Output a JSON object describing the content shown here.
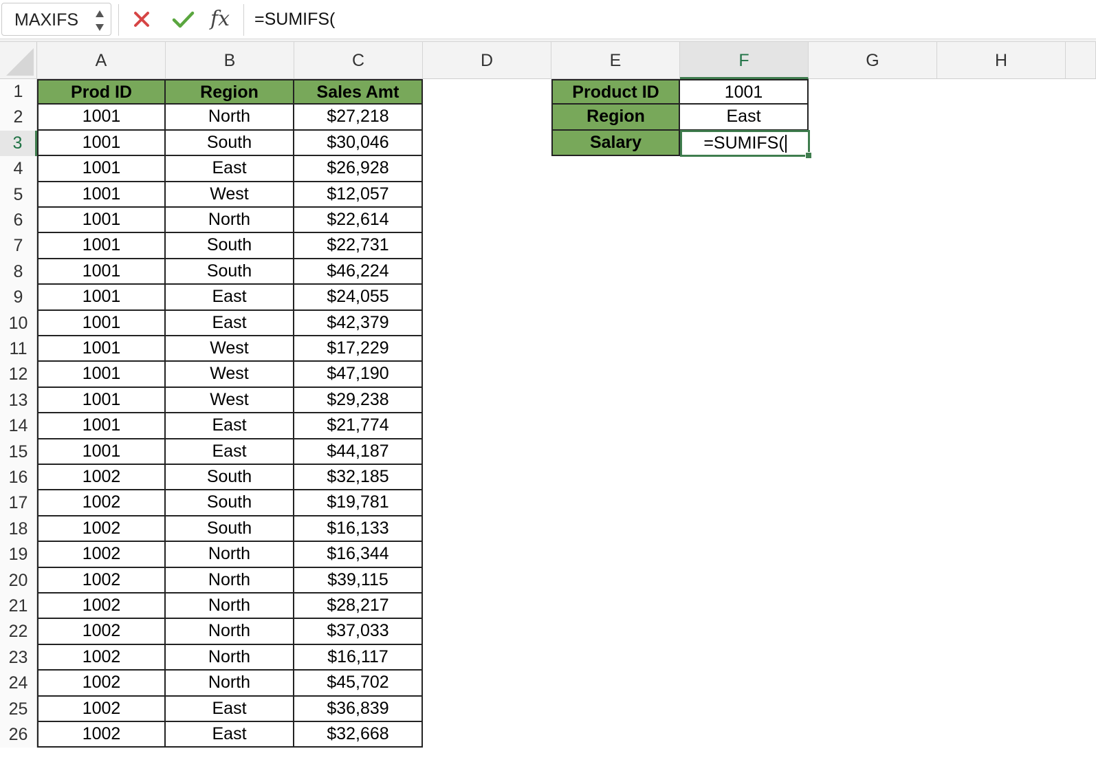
{
  "formula_bar": {
    "name_box": "MAXIFS",
    "cancel_icon": "close-icon",
    "enter_icon": "checkmark-icon",
    "fx_label": "fx",
    "formula": "=SUMIFS("
  },
  "grid": {
    "columns": [
      "A",
      "B",
      "C",
      "D",
      "E",
      "F",
      "G",
      "H"
    ],
    "selected_column": "F",
    "selected_row": "3",
    "rows": [
      "1",
      "2",
      "3",
      "4",
      "5",
      "6",
      "7",
      "8",
      "9",
      "10",
      "11",
      "12",
      "13",
      "14",
      "15",
      "16",
      "17",
      "18",
      "19",
      "20",
      "21",
      "22",
      "23",
      "24",
      "25",
      "26"
    ]
  },
  "table": {
    "headers": [
      "Prod ID",
      "Region",
      "Sales Amt"
    ],
    "rows": [
      [
        "1001",
        "North",
        "$27,218"
      ],
      [
        "1001",
        "South",
        "$30,046"
      ],
      [
        "1001",
        "East",
        "$26,928"
      ],
      [
        "1001",
        "West",
        "$12,057"
      ],
      [
        "1001",
        "North",
        "$22,614"
      ],
      [
        "1001",
        "South",
        "$22,731"
      ],
      [
        "1001",
        "South",
        "$46,224"
      ],
      [
        "1001",
        "East",
        "$24,055"
      ],
      [
        "1001",
        "East",
        "$42,379"
      ],
      [
        "1001",
        "West",
        "$17,229"
      ],
      [
        "1001",
        "West",
        "$47,190"
      ],
      [
        "1001",
        "West",
        "$29,238"
      ],
      [
        "1001",
        "East",
        "$21,774"
      ],
      [
        "1001",
        "East",
        "$44,187"
      ],
      [
        "1002",
        "South",
        "$32,185"
      ],
      [
        "1002",
        "South",
        "$19,781"
      ],
      [
        "1002",
        "South",
        "$16,133"
      ],
      [
        "1002",
        "North",
        "$16,344"
      ],
      [
        "1002",
        "North",
        "$39,115"
      ],
      [
        "1002",
        "North",
        "$28,217"
      ],
      [
        "1002",
        "North",
        "$37,033"
      ],
      [
        "1002",
        "North",
        "$16,117"
      ],
      [
        "1002",
        "North",
        "$45,702"
      ],
      [
        "1002",
        "East",
        "$36,839"
      ],
      [
        "1002",
        "East",
        "$32,668"
      ]
    ]
  },
  "lookup": {
    "labels": [
      "Product ID",
      "Region",
      "Salary"
    ],
    "values": [
      "1001",
      "East",
      "=SUMIFS("
    ]
  },
  "colors": {
    "header_green": "#78a85a",
    "selection_green": "#3f7d4e",
    "cancel_red": "#d64545",
    "enter_green": "#5aa63f"
  }
}
